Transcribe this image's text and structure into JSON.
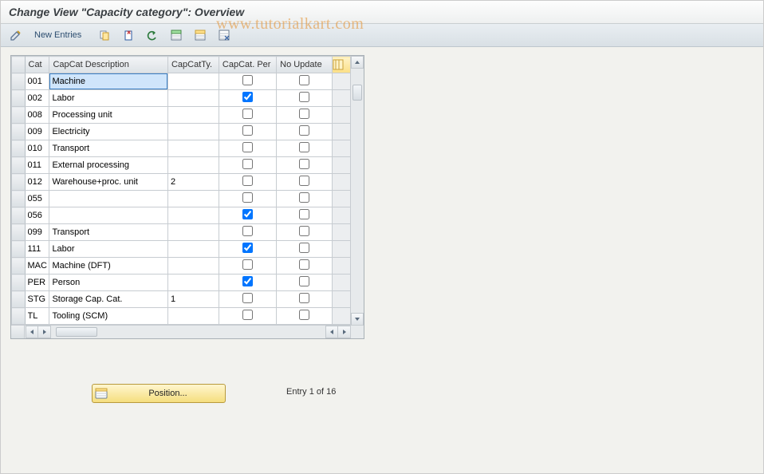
{
  "title": "Change View \"Capacity category\": Overview",
  "watermark": "www.tutorialkart.com",
  "toolbar": {
    "new_entries": "New Entries"
  },
  "columns": {
    "cat": "Cat",
    "desc": "CapCat Description",
    "ty": "CapCatTy.",
    "per": "CapCat. Per",
    "upd": "No Update"
  },
  "rows": [
    {
      "cat": "001",
      "desc": "Machine",
      "ty": "",
      "per": false,
      "upd": false,
      "selected": true
    },
    {
      "cat": "002",
      "desc": "Labor",
      "ty": "",
      "per": true,
      "upd": false
    },
    {
      "cat": "008",
      "desc": "Processing unit",
      "ty": "",
      "per": false,
      "upd": false
    },
    {
      "cat": "009",
      "desc": "Electricity",
      "ty": "",
      "per": false,
      "upd": false
    },
    {
      "cat": "010",
      "desc": "Transport",
      "ty": "",
      "per": false,
      "upd": false
    },
    {
      "cat": "011",
      "desc": "External processing",
      "ty": "",
      "per": false,
      "upd": false
    },
    {
      "cat": "012",
      "desc": "Warehouse+proc. unit",
      "ty": "2",
      "per": false,
      "upd": false
    },
    {
      "cat": "055",
      "desc": "",
      "ty": "",
      "per": false,
      "upd": false
    },
    {
      "cat": "056",
      "desc": "",
      "ty": "",
      "per": true,
      "upd": false
    },
    {
      "cat": "099",
      "desc": "Transport",
      "ty": "",
      "per": false,
      "upd": false
    },
    {
      "cat": "111",
      "desc": "Labor",
      "ty": "",
      "per": true,
      "upd": false
    },
    {
      "cat": "MAC",
      "desc": "Machine (DFT)",
      "ty": "",
      "per": false,
      "upd": false
    },
    {
      "cat": "PER",
      "desc": "Person",
      "ty": "",
      "per": true,
      "upd": false
    },
    {
      "cat": "STG",
      "desc": "Storage Cap. Cat.",
      "ty": "1",
      "per": false,
      "upd": false
    },
    {
      "cat": "TL",
      "desc": "Tooling (SCM)",
      "ty": "",
      "per": false,
      "upd": false
    }
  ],
  "footer": {
    "position_label": "Position...",
    "entry_info": "Entry 1 of 16"
  }
}
